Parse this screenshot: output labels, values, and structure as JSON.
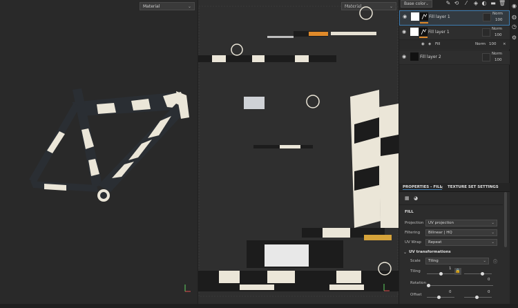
{
  "viewport3d": {
    "material_dropdown": "Material"
  },
  "viewport2d": {
    "material_dropdown": "Material"
  },
  "layers": {
    "channel_dropdown": "Base color",
    "rows": [
      {
        "name": "Fill layer 1",
        "blend": "Norm",
        "opacity": "100",
        "selected": true
      },
      {
        "name": "Fill layer 1",
        "blend": "Norm",
        "opacity": "100",
        "selected": false
      },
      {
        "name": "Fill layer 2",
        "blend": "Norm",
        "opacity": "100",
        "selected": false
      }
    ],
    "fill_sub": {
      "name": "Fill",
      "blend": "Norm",
      "opacity": "100"
    }
  },
  "properties": {
    "tab_active": "PROPERTIES - FILL",
    "tab_other": "TEXTURE SET SETTINGS",
    "section_fill": "FILL",
    "projection_label": "Projection",
    "projection_value": "UV projection",
    "filtering_label": "Filtering",
    "filtering_value": "Bilinear | HQ",
    "uvwrap_label": "UV Wrap",
    "uvwrap_value": "Repeat",
    "section_uv": "UV transformations",
    "scale_label": "Scale",
    "scale_value": "Tiling",
    "tiling_label": "Tiling",
    "tiling_value_top": "1",
    "tiling_value": "0",
    "rotation_label": "Rotation",
    "rotation_value": "0",
    "offset_label": "Offset",
    "offset_value_a": "0",
    "offset_value_b": "0"
  },
  "colors": {
    "accent": "#3f7fb5",
    "orange": "#e08a2a",
    "frame_dark": "#2a2e33",
    "frame_light": "#ebe6d8"
  }
}
